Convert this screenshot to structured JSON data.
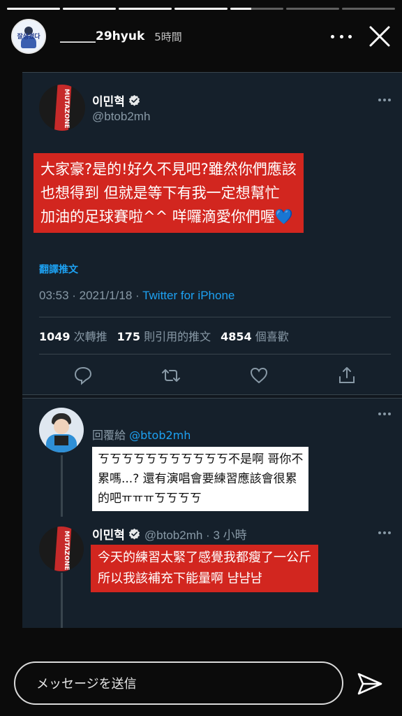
{
  "story": {
    "progress": [
      1,
      1,
      1,
      1,
      0.4,
      0,
      0
    ],
    "username": "______29hyuk",
    "time": "5時間",
    "avatar_text": "잘생겼다"
  },
  "tweet": {
    "name": "이민혁",
    "handle": "@btob2mh",
    "avatar_text": "MUTAZONE",
    "caption_lines": [
      "大家豪?是的!好久不見吧?雖然你們應該",
      "也想得到 但就是等下有我一定想幫忙",
      "加油的足球賽啦^^ 咩囉滴愛你們喔💙"
    ],
    "translate_label": "翻譯推文",
    "time": "03:53 · 2021/1/18 · ",
    "source": "Twitter for iPhone",
    "stats": {
      "retweets_count": "1049",
      "retweets_label": "次轉推",
      "quotes_count": "175",
      "quotes_label": "則引用的推文",
      "likes_count": "4854",
      "likes_label": "個喜歡"
    }
  },
  "reply": {
    "reply_prefix": "回覆給 ",
    "reply_to": "@btob2mh",
    "caption_lines": [
      "ㄎㄎㄎㄎㄎㄎㄎㄎㄎㄎㄎ不是啊 哥你不",
      "累嗎...? 還有演唱會要練習應該會很累",
      "的吧ㅠㅠㅠㄎㄎㄎㄎ"
    ]
  },
  "reply2": {
    "name": "이민혁",
    "handle_time": "@btob2mh · 3 小時",
    "caption_lines": [
      "今天的練習太緊了感覺我都瘦了一公斤",
      "所以我該補充下能量啊 냠냠냠"
    ]
  },
  "message": {
    "placeholder": "メッセージを送信"
  },
  "colors": {
    "twitter_bg": "#15202b",
    "twitter_blue": "#1da1f2",
    "muted": "#8899a6",
    "caption_red": "#d2261f"
  }
}
